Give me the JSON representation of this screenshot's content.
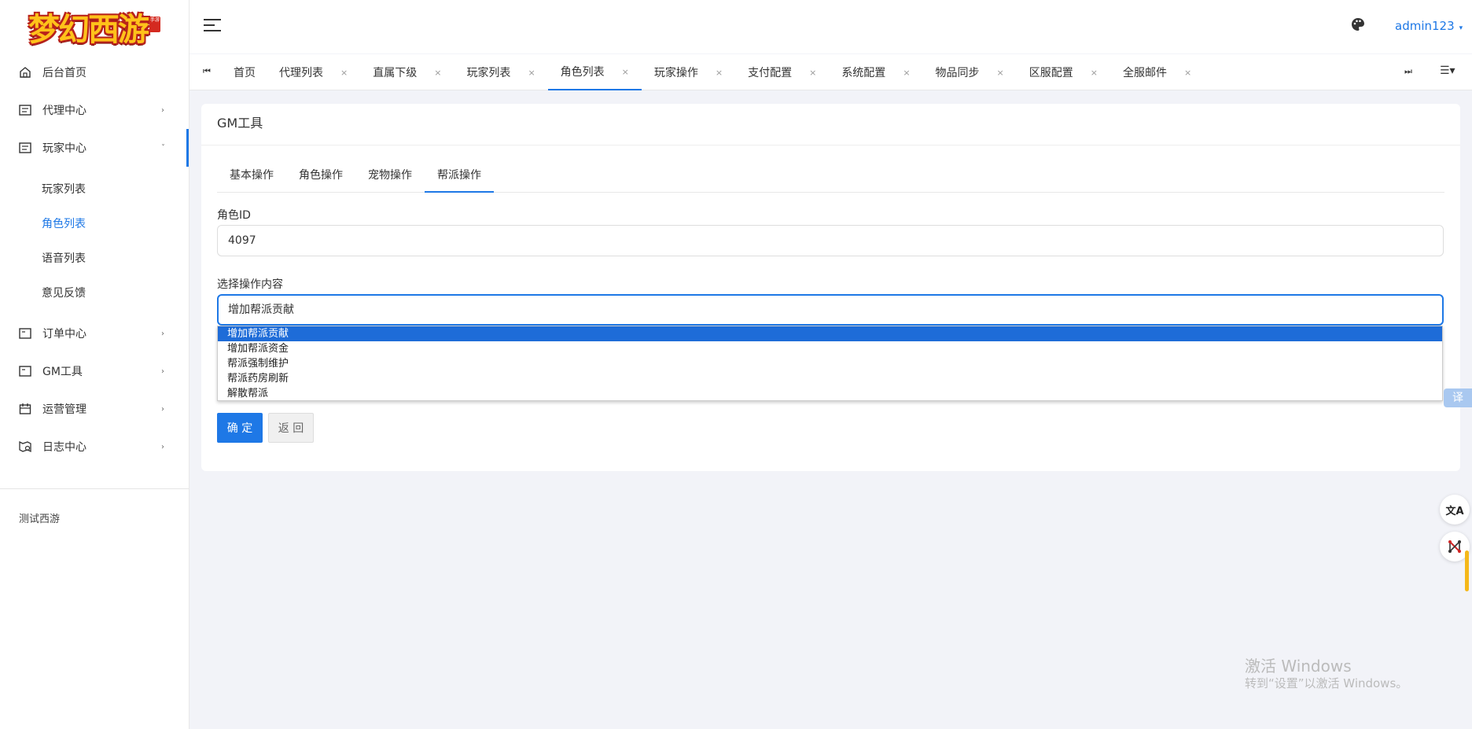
{
  "app": {
    "logo_text": "梦幻西游",
    "logo_seal": "手游"
  },
  "sidebar": {
    "menu": [
      {
        "label": "后台首页",
        "icon": "home-icon"
      },
      {
        "label": "代理中心",
        "icon": "card-icon",
        "arrow": "›"
      },
      {
        "label": "玩家中心",
        "icon": "card-icon",
        "arrow": "ˇ",
        "open": true,
        "children": [
          {
            "label": "玩家列表"
          },
          {
            "label": "角色列表",
            "active": true
          },
          {
            "label": "语音列表"
          },
          {
            "label": "意见反馈"
          }
        ]
      },
      {
        "label": "订单中心",
        "icon": "order-icon",
        "arrow": "›"
      },
      {
        "label": "GM工具",
        "icon": "tool-icon",
        "arrow": "›"
      },
      {
        "label": "运营管理",
        "icon": "calendar-icon",
        "arrow": "›"
      },
      {
        "label": "日志中心",
        "icon": "log-icon",
        "arrow": "›"
      }
    ],
    "footer": "测试西游"
  },
  "header": {
    "user": "admin123",
    "user_caret": "▾"
  },
  "tabbar": {
    "first_glyph": "⏮",
    "last_glyph": "⏭",
    "menu_glyph": "☰▾",
    "close_glyph": "×",
    "tabs": [
      {
        "label": "首页",
        "closable": false
      },
      {
        "label": "代理列表",
        "closable": true
      },
      {
        "label": "直属下级",
        "closable": true
      },
      {
        "label": "玩家列表",
        "closable": true
      },
      {
        "label": "角色列表",
        "closable": true,
        "active": true
      },
      {
        "label": "玩家操作",
        "closable": true
      },
      {
        "label": "支付配置",
        "closable": true
      },
      {
        "label": "系统配置",
        "closable": true
      },
      {
        "label": "物品同步",
        "closable": true
      },
      {
        "label": "区服配置",
        "closable": true
      },
      {
        "label": "全服邮件",
        "closable": true
      }
    ]
  },
  "card": {
    "title": "GM工具",
    "subtabs": [
      "基本操作",
      "角色操作",
      "宠物操作",
      "帮派操作"
    ],
    "active_subtab": 3,
    "role_id_label": "角色ID",
    "role_id_value": "4097",
    "op_label": "选择操作内容",
    "op_value": "增加帮派贡献",
    "confirm_button": "确 定",
    "back_button": "返 回"
  },
  "dropdown": {
    "options": [
      "增加帮派贡献",
      "增加帮派资金",
      "帮派强制维护",
      "帮派药房刷新",
      "解散帮派"
    ],
    "selected_index": 0
  },
  "floating": {
    "translate_tab": "译",
    "translate_fab": "文A",
    "network_fab": "⛓"
  },
  "watermark": {
    "line1": "激活 Windows",
    "line2": "转到“设置”以激活 Windows。"
  },
  "colors": {
    "accent": "#1e78e6",
    "selected_option": "#1e6cd8",
    "background": "#f2f3f8"
  }
}
